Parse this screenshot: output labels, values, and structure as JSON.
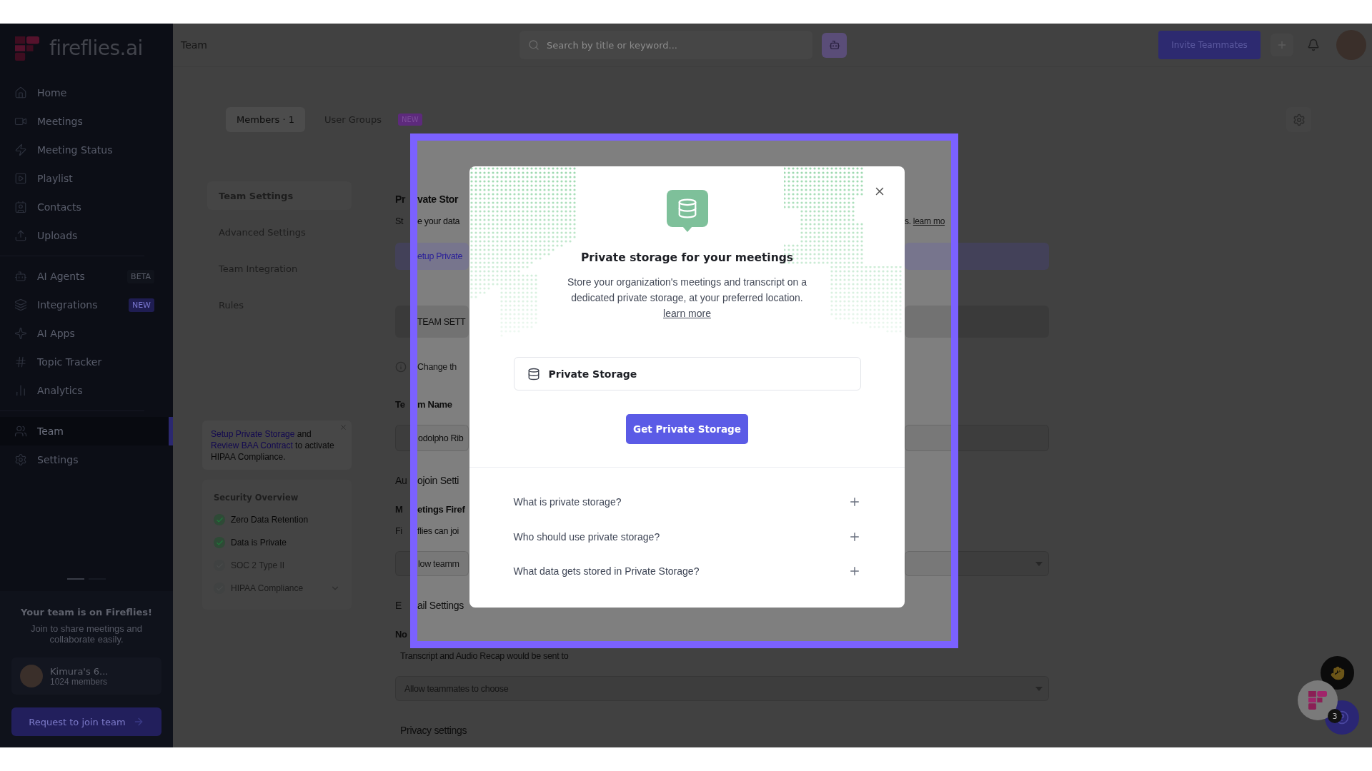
{
  "sidebar": {
    "logo": "fireflies.ai",
    "groups": [
      [
        {
          "label": "Home",
          "selected": false
        },
        {
          "label": "Meetings",
          "selected": false
        },
        {
          "label": "Meeting Status",
          "selected": false
        },
        {
          "label": "Playlist",
          "selected": false
        },
        {
          "label": "Contacts",
          "selected": false
        },
        {
          "label": "Uploads",
          "selected": false
        }
      ],
      [
        {
          "label": "AI Agents",
          "selected": false,
          "badge": "BETA",
          "kind": "beta"
        },
        {
          "label": "Integrations",
          "selected": false,
          "badge": "NEW",
          "kind": "new"
        },
        {
          "label": "AI Apps",
          "selected": false
        },
        {
          "label": "Topic Tracker",
          "selected": false
        },
        {
          "label": "Analytics",
          "selected": false
        }
      ],
      [
        {
          "label": "Team",
          "selected": true
        },
        {
          "label": "Settings",
          "selected": false
        }
      ]
    ],
    "pager": [
      {
        "selected": true
      },
      {
        "selected": false
      }
    ],
    "promo": {
      "title": "Your team is on Fireflies!",
      "text": "Join to share meetings and collaborate easily."
    },
    "team_card": {
      "name": "Kimura's 6...",
      "members": "1024 members"
    },
    "join_button": "Request to join team"
  },
  "header": {
    "title": "Team",
    "search_placeholder": "Search by title or keyword...",
    "invite_button": "Invite Teammates"
  },
  "tabs": [
    {
      "label": "Members · 1",
      "selected": true
    },
    {
      "label": "User Groups",
      "selected": false,
      "badge": "NEW"
    }
  ],
  "settings_menu": [
    {
      "label": "Team Settings",
      "selected": true
    },
    {
      "label": "Advanced Settings",
      "selected": false
    },
    {
      "label": "Team Integration",
      "selected": false
    },
    {
      "label": "Rules",
      "selected": false
    }
  ],
  "hipaa_notice": {
    "parts": [
      {
        "kind": "link",
        "text": "Setup Private Storage"
      },
      {
        "kind": "text",
        "text": " and "
      },
      {
        "kind": "link",
        "text": "Review BAA Contract"
      },
      {
        "kind": "text",
        "text": " to activate HIPAA Compliance."
      }
    ]
  },
  "security_overview": {
    "title": "Security Overview",
    "items": [
      {
        "label": "Zero Data Retention",
        "checked": true,
        "kind": "plain"
      },
      {
        "label": "Data is Private",
        "checked": true,
        "kind": "plain"
      },
      {
        "label": "SOC 2 Type II",
        "checked": false,
        "kind": "plain"
      },
      {
        "label": "HIPAA Compliance",
        "checked": false,
        "kind": "expandable"
      }
    ]
  },
  "content_rows": [
    {
      "kind": "heading",
      "left": "Pr",
      "inside": "vate Stor"
    },
    {
      "kind": "text",
      "left": "St",
      "inside": "e your data",
      "right": "s.",
      "right_link": "learn mo"
    },
    {
      "kind": "button",
      "inside": "etup Private"
    },
    {
      "kind": "band",
      "inside": "TEAM SETT"
    },
    {
      "kind": "info",
      "inside": "Change th"
    },
    {
      "kind": "label",
      "left": "Te",
      "inside": "m Name"
    },
    {
      "kind": "input",
      "inside": "odolpho Rib"
    },
    {
      "kind": "section",
      "left": "Au",
      "inside": "ojoin Setti"
    },
    {
      "kind": "label",
      "left": "M",
      "inside": "etings Firef"
    },
    {
      "kind": "text",
      "left": "Fi",
      "inside": "flies can joi"
    },
    {
      "kind": "select",
      "inside": "low teamm"
    },
    {
      "kind": "section",
      "left": "E",
      "inside": "ail Settings"
    },
    {
      "kind": "label",
      "left": "No"
    },
    {
      "kind": "text",
      "full": "Transcript and Audio Recap would be sent to"
    },
    {
      "kind": "select",
      "full": "Allow teammates to choose"
    },
    {
      "kind": "section",
      "full": "Privacy settings"
    }
  ],
  "modal": {
    "title": "Private storage for your meetings",
    "description": "Store your organization's meetings and transcript on a dedicated private storage, at your preferred location.",
    "learn_more": "learn more",
    "option": "Private Storage",
    "button": "Get Private Storage",
    "faq": [
      {
        "question": "What is private storage?",
        "expanded": false
      },
      {
        "question": "Who should use private storage?",
        "expanded": false
      },
      {
        "question": "What data gets stored in Private Storage?",
        "expanded": false
      }
    ]
  },
  "chat_badge": "3"
}
